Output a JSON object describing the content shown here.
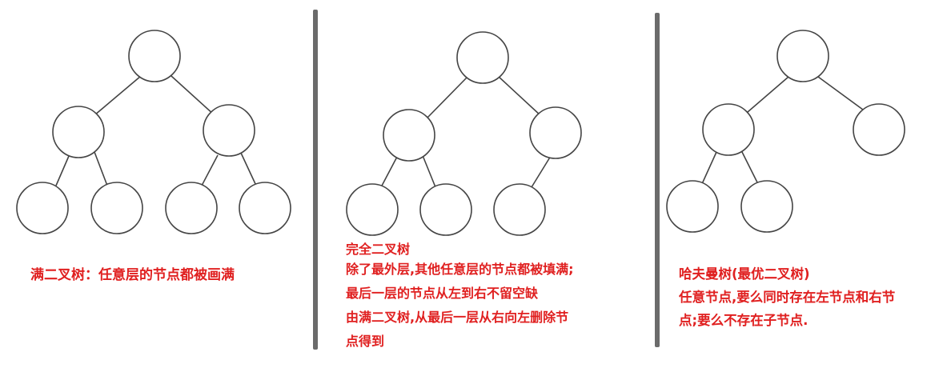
{
  "panels": [
    {
      "id": "full",
      "caption_lines": [
        "满二叉树：任意层的节点都被画满"
      ]
    },
    {
      "id": "complete",
      "caption_lines": [
        "完全二叉树",
        "除了最外层,其他任意层的节点都被填满;",
        "最后一层的节点从左到右不留空缺",
        "由满二叉树,从最后一层从右向左删除节",
        "点得到"
      ]
    },
    {
      "id": "huffman",
      "caption_lines": [
        "哈夫曼树(最优二叉树)",
        "任意节点,要么同时存在左节点和右节",
        "点;要么不存在子节点."
      ]
    }
  ],
  "colors": {
    "caption": "#e02020",
    "divider": "#6b6b6b",
    "stroke": "#444444"
  }
}
